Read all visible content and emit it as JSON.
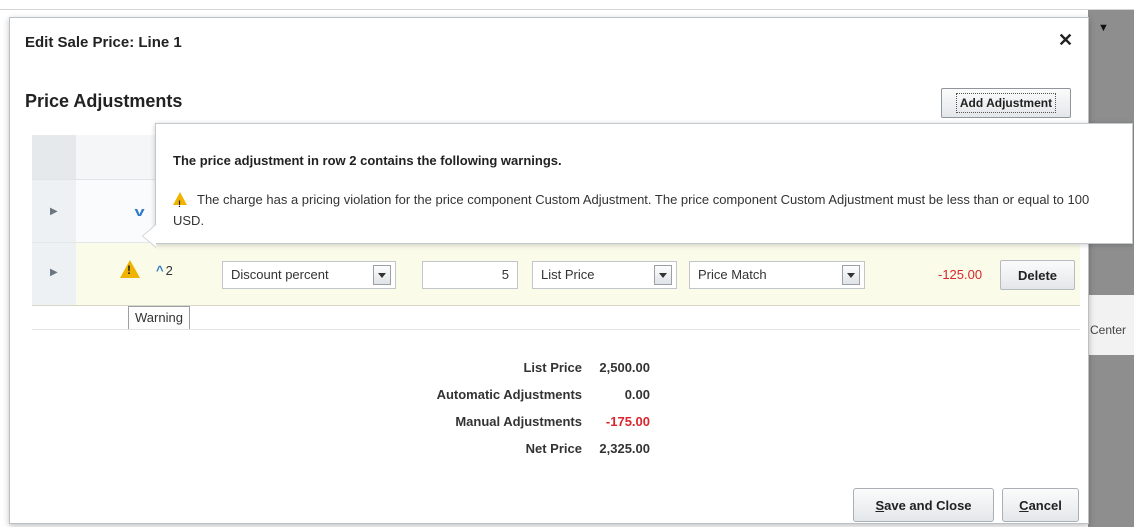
{
  "dialog": {
    "title": "Edit Sale Price: Line 1",
    "close_label": "✕"
  },
  "section": {
    "title": "Price Adjustments",
    "add_button": "Add Adjustment"
  },
  "warning_popup": {
    "heading": "The price adjustment in row 2 contains the following warnings.",
    "message": "The charge has a pricing violation for the price component Custom Adjustment. The price component Custom Adjustment must be less than or equal to 100 USD."
  },
  "row2": {
    "number": "2",
    "adjustment_type": "Discount percent",
    "value": "5",
    "basis": "List Price",
    "reason": "Price Match",
    "amount": "-125.00",
    "delete_label": "Delete"
  },
  "tooltip": "Warning",
  "totals": [
    {
      "label": "List Price",
      "value": "2,500.00",
      "negative": false
    },
    {
      "label": "Automatic Adjustments",
      "value": "0.00",
      "negative": false
    },
    {
      "label": "Manual Adjustments",
      "value": "-175.00",
      "negative": true
    },
    {
      "label": "Net Price",
      "value": "2,325.00",
      "negative": false
    }
  ],
  "footer": {
    "save_first": "S",
    "save_rest": "ave and Close",
    "cancel_first": "C",
    "cancel_rest": "ancel"
  },
  "background": {
    "partial_text": "Center"
  },
  "colors": {
    "warning": "#f0b400",
    "negative": "#d8262c",
    "link_blue": "#2d7ac6"
  }
}
